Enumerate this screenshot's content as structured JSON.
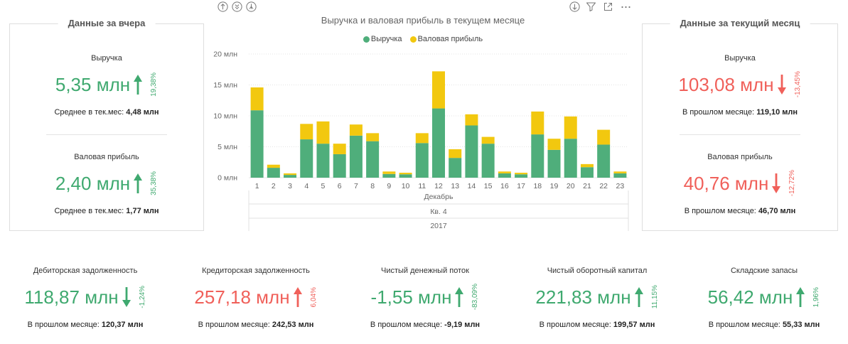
{
  "visual_header": {
    "left_icons": [
      "drill-up-icon",
      "go-to-next-level-icon",
      "expand-hierarchy-icon"
    ],
    "right_icons": [
      "drill-down-mode-icon",
      "filter-icon",
      "focus-mode-icon",
      "more-options-icon"
    ]
  },
  "yesterday": {
    "title": "Данные за вчера",
    "revenue": {
      "label": "Выручка",
      "value": "5,35 млн",
      "arrow_icon": "arrow-up-icon",
      "change": "19,38%",
      "color": "#3fa96f",
      "footer_label": "Среднее в тек.мес:",
      "footer_value": "4,48 млн"
    },
    "gross_profit": {
      "label": "Валовая прибыль",
      "value": "2,40 млн",
      "arrow_icon": "arrow-up-icon",
      "change": "35,38%",
      "color": "#3fa96f",
      "footer_label": "Среднее в тек.мес:",
      "footer_value": "1,77 млн"
    }
  },
  "current_month": {
    "title": "Данные за текущий месяц",
    "revenue": {
      "label": "Выручка",
      "value": "103,08 млн",
      "arrow_icon": "arrow-down-icon",
      "change": "-13,45%",
      "color": "#f0605a",
      "footer_label": "В прошлом месяце:",
      "footer_value": "119,10 млн"
    },
    "gross_profit": {
      "label": "Валовая прибыль",
      "value": "40,76 млн",
      "arrow_icon": "arrow-down-icon",
      "change": "-12,72%",
      "color": "#f0605a",
      "footer_label": "В прошлом месяце:",
      "footer_value": "46,70 млн"
    }
  },
  "chart_data": {
    "type": "bar",
    "stacked": true,
    "title": "Выручка и валовая прибыль в текущем месяце",
    "categories": [
      "1",
      "2",
      "3",
      "4",
      "5",
      "6",
      "7",
      "8",
      "9",
      "10",
      "11",
      "12",
      "13",
      "14",
      "15",
      "16",
      "17",
      "18",
      "19",
      "20",
      "21",
      "22",
      "23"
    ],
    "x_hierarchy": [
      "Декабрь",
      "Кв. 4",
      "2017"
    ],
    "ylim": [
      0,
      20
    ],
    "y_ticks": [
      {
        "value": 0,
        "label": "0 млн"
      },
      {
        "value": 5,
        "label": "5 млн"
      },
      {
        "value": 10,
        "label": "10 млн"
      },
      {
        "value": 15,
        "label": "15 млн"
      },
      {
        "value": 20,
        "label": "20 млн"
      }
    ],
    "grid": true,
    "legend_position": "top-center",
    "series": [
      {
        "name": "Выручка",
        "color": "#4fae7b",
        "values": [
          10.9,
          1.6,
          0.45,
          6.2,
          5.5,
          3.8,
          6.8,
          5.9,
          0.6,
          0.55,
          5.6,
          11.2,
          3.2,
          8.45,
          5.5,
          0.7,
          0.55,
          7.0,
          4.5,
          6.3,
          1.7,
          5.35,
          0.7
        ]
      },
      {
        "name": "Валовая прибыль",
        "color": "#f2c80f",
        "values": [
          3.7,
          0.5,
          0.25,
          2.5,
          3.6,
          1.7,
          1.8,
          1.3,
          0.4,
          0.25,
          1.6,
          6.0,
          1.4,
          1.8,
          1.1,
          0.3,
          0.25,
          3.7,
          1.8,
          3.6,
          0.5,
          2.4,
          0.3
        ]
      }
    ]
  },
  "kpis": [
    {
      "label": "Дебиторская задолженность",
      "value": "118,87 млн",
      "arrow_icon": "arrow-down-icon",
      "change": "-1,24%",
      "color": "#3fa96f",
      "footer_label": "В прошлом месяце:",
      "footer_value": "120,37 млн"
    },
    {
      "label": "Кредиторская задолженность",
      "value": "257,18 млн",
      "arrow_icon": "arrow-up-icon",
      "change": "6,04%",
      "color": "#f0605a",
      "footer_label": "В прошлом месяце:",
      "footer_value": "242,53 млн"
    },
    {
      "label": "Чистый денежный поток",
      "value": "-1,55 млн",
      "arrow_icon": "arrow-up-icon",
      "change": "-83,09%",
      "color": "#3fa96f",
      "footer_label": "В прошлом месяце:",
      "footer_value": "-9,19 млн"
    },
    {
      "label": "Чистый оборотный капитал",
      "value": "221,83 млн",
      "arrow_icon": "arrow-up-icon",
      "change": "11,15%",
      "color": "#3fa96f",
      "footer_label": "В прошлом месяце:",
      "footer_value": "199,57 млн"
    },
    {
      "label": "Складские запасы",
      "value": "56,42 млн",
      "arrow_icon": "arrow-up-icon",
      "change": "1,96%",
      "color": "#3fa96f",
      "footer_label": "В прошлом месяце:",
      "footer_value": "55,33 млн"
    }
  ]
}
